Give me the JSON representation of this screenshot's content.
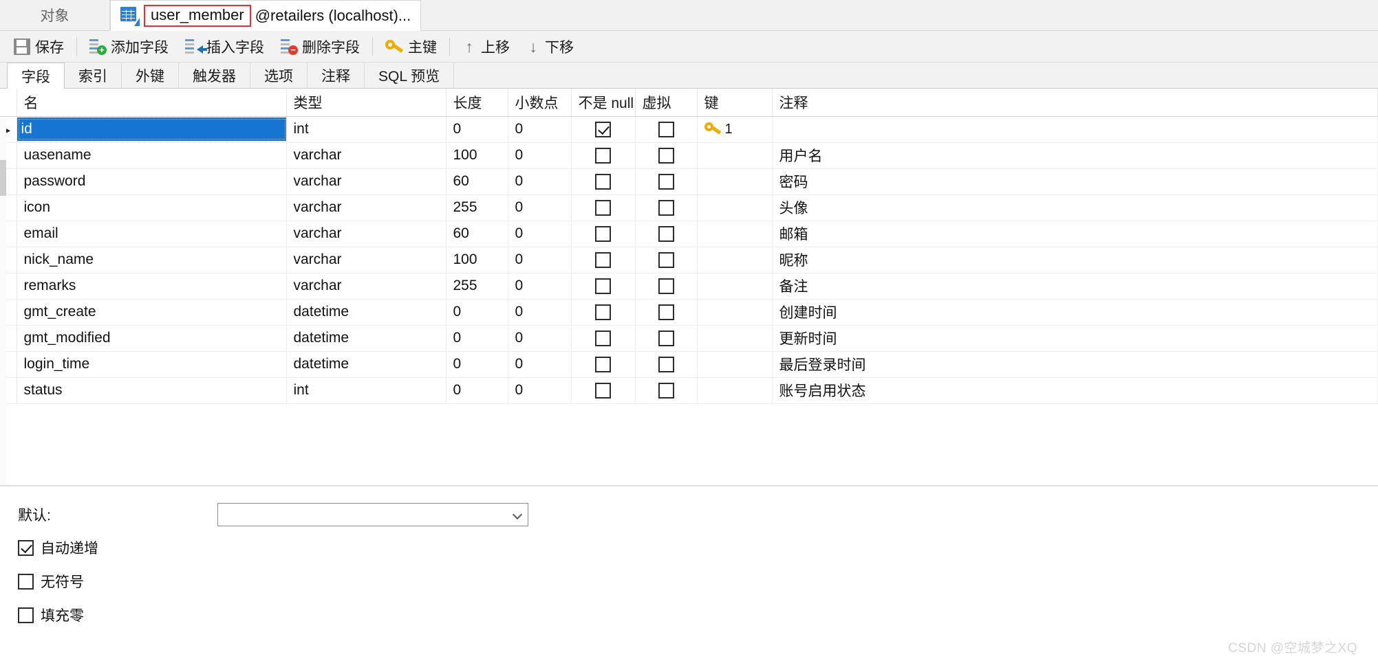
{
  "window_tabs": [
    {
      "label": "对象",
      "active": false,
      "has_icon": false
    },
    {
      "label_boxed": "user_member",
      "label_suffix": "@retailers (localhost)...",
      "active": true,
      "has_icon": true,
      "icon": "table-edit-icon",
      "highlight_color": "#e03131"
    }
  ],
  "toolbar": {
    "save": {
      "label": "保存",
      "icon": "save-icon"
    },
    "add_field": {
      "label": "添加字段",
      "icon": "add-field-icon"
    },
    "insert_field": {
      "label": "插入字段",
      "icon": "insert-field-icon"
    },
    "delete_field": {
      "label": "删除字段",
      "icon": "delete-field-icon"
    },
    "primary_key": {
      "label": "主键",
      "icon": "key-icon"
    },
    "move_up": {
      "label": "上移",
      "icon": "arrow-up-icon"
    },
    "move_down": {
      "label": "下移",
      "icon": "arrow-down-icon"
    }
  },
  "section_tabs": [
    {
      "label": "字段",
      "active": true
    },
    {
      "label": "索引",
      "active": false
    },
    {
      "label": "外键",
      "active": false
    },
    {
      "label": "触发器",
      "active": false
    },
    {
      "label": "选项",
      "active": false
    },
    {
      "label": "注释",
      "active": false
    },
    {
      "label": "SQL 预览",
      "active": false
    }
  ],
  "grid": {
    "columns": [
      {
        "key": "name",
        "label": "名"
      },
      {
        "key": "type",
        "label": "类型"
      },
      {
        "key": "length",
        "label": "长度"
      },
      {
        "key": "decimals",
        "label": "小数点"
      },
      {
        "key": "not_null",
        "label": "不是 null"
      },
      {
        "key": "virtual",
        "label": "虚拟"
      },
      {
        "key": "key",
        "label": "键"
      },
      {
        "key": "comment",
        "label": "注释"
      }
    ],
    "selection_color": "#1675d1",
    "rows": [
      {
        "marker": "▸",
        "name": "id",
        "type": "int",
        "length": "0",
        "decimals": "0",
        "not_null": true,
        "virtual": false,
        "key": "1",
        "comment": ""
      },
      {
        "marker": "",
        "name": "uasename",
        "type": "varchar",
        "length": "100",
        "decimals": "0",
        "not_null": false,
        "virtual": false,
        "key": "",
        "comment": "用户名"
      },
      {
        "marker": "",
        "name": "password",
        "type": "varchar",
        "length": "60",
        "decimals": "0",
        "not_null": false,
        "virtual": false,
        "key": "",
        "comment": "密码"
      },
      {
        "marker": "",
        "name": "icon",
        "type": "varchar",
        "length": "255",
        "decimals": "0",
        "not_null": false,
        "virtual": false,
        "key": "",
        "comment": "头像"
      },
      {
        "marker": "",
        "name": "email",
        "type": "varchar",
        "length": "60",
        "decimals": "0",
        "not_null": false,
        "virtual": false,
        "key": "",
        "comment": "邮箱"
      },
      {
        "marker": "",
        "name": "nick_name",
        "type": "varchar",
        "length": "100",
        "decimals": "0",
        "not_null": false,
        "virtual": false,
        "key": "",
        "comment": "昵称"
      },
      {
        "marker": "",
        "name": "remarks",
        "type": "varchar",
        "length": "255",
        "decimals": "0",
        "not_null": false,
        "virtual": false,
        "key": "",
        "comment": "备注"
      },
      {
        "marker": "",
        "name": "gmt_create",
        "type": "datetime",
        "length": "0",
        "decimals": "0",
        "not_null": false,
        "virtual": false,
        "key": "",
        "comment": "创建时间"
      },
      {
        "marker": "",
        "name": "gmt_modified",
        "type": "datetime",
        "length": "0",
        "decimals": "0",
        "not_null": false,
        "virtual": false,
        "key": "",
        "comment": "更新时间"
      },
      {
        "marker": "",
        "name": "login_time",
        "type": "datetime",
        "length": "0",
        "decimals": "0",
        "not_null": false,
        "virtual": false,
        "key": "",
        "comment": "最后登录时间"
      },
      {
        "marker": "",
        "name": "status",
        "type": "int",
        "length": "0",
        "decimals": "0",
        "not_null": false,
        "virtual": false,
        "key": "",
        "comment": "账号启用状态"
      }
    ],
    "selected_row_index": 0
  },
  "properties": {
    "default_label": "默认:",
    "default_value": "",
    "checkboxes": [
      {
        "label": "自动递增",
        "checked": true
      },
      {
        "label": "无符号",
        "checked": false
      },
      {
        "label": "填充零",
        "checked": false
      }
    ]
  },
  "watermark": "CSDN @空城梦之XQ"
}
